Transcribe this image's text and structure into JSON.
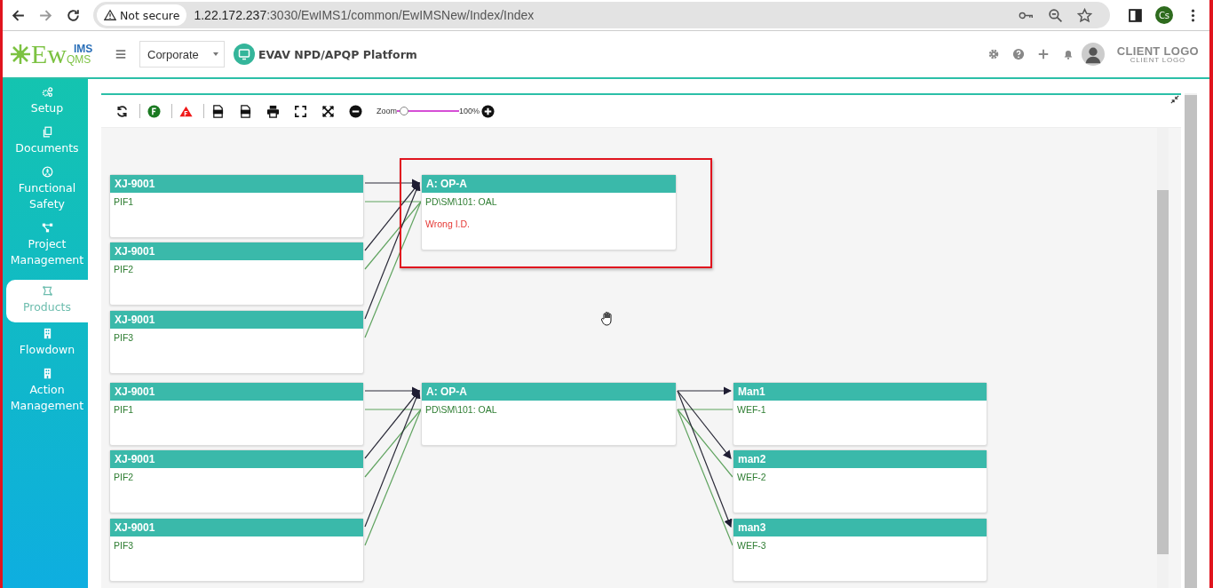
{
  "browser": {
    "security": "Not secure",
    "url_host": "1.22.172.237",
    "url_rest": ":3030/EwIMS1/common/EwIMSNew/Index/Index",
    "profile": "Cs"
  },
  "header": {
    "logo": {
      "main": "Ew",
      "top": "IMS",
      "bottom": "QMS"
    },
    "org_select": "Corporate",
    "platform": "EVAV NPD/APQP Platform",
    "client_logo": "CLIENT LOGO",
    "client_logo_sub": "CLIENT LOGO"
  },
  "sidebar": {
    "items": [
      {
        "label": "Setup",
        "selected": false
      },
      {
        "label": "Documents",
        "selected": false
      },
      {
        "label": "Functional Safety",
        "selected": false
      },
      {
        "label": "Project Management",
        "selected": false
      },
      {
        "label": "Products",
        "selected": true
      },
      {
        "label": "Flowdown",
        "selected": false
      },
      {
        "label": "Action Management",
        "selected": false
      }
    ]
  },
  "toolbar": {
    "zoom_label": "Zoom",
    "zoom": {
      "level": 0.1
    },
    "zoom_value": "100%"
  },
  "diagram": {
    "nodes": [
      {
        "title": "XJ-9001",
        "flagged": false,
        "rows": [
          {
            "text": "PIF1",
            "kind": "ok"
          }
        ]
      },
      {
        "title": "XJ-9001",
        "flagged": false,
        "rows": [
          {
            "text": "PIF2",
            "kind": "ok"
          }
        ]
      },
      {
        "title": "XJ-9001",
        "flagged": false,
        "rows": [
          {
            "text": "PIF3",
            "kind": "ok"
          }
        ]
      },
      {
        "title": "A: OP-A",
        "flagged": true,
        "rows": [
          {
            "text": "PD\\SM\\101: OAL",
            "kind": "ok"
          },
          {
            "text": "Wrong I.D.",
            "kind": "error"
          }
        ]
      },
      {
        "title": "XJ-9001",
        "flagged": false,
        "rows": [
          {
            "text": "PIF1",
            "kind": "ok"
          }
        ]
      },
      {
        "title": "XJ-9001",
        "flagged": false,
        "rows": [
          {
            "text": "PIF2",
            "kind": "ok"
          }
        ]
      },
      {
        "title": "XJ-9001",
        "flagged": false,
        "rows": [
          {
            "text": "PIF3",
            "kind": "ok"
          }
        ]
      },
      {
        "title": "A: OP-A",
        "flagged": false,
        "rows": [
          {
            "text": "PD\\SM\\101: OAL",
            "kind": "ok"
          }
        ]
      },
      {
        "title": "Man1",
        "flagged": false,
        "rows": [
          {
            "text": "WEF-1",
            "kind": "ok"
          }
        ]
      },
      {
        "title": "man2",
        "flagged": false,
        "rows": [
          {
            "text": "WEF-2",
            "kind": "ok"
          }
        ]
      },
      {
        "title": "man3",
        "flagged": false,
        "rows": [
          {
            "text": "WEF-3",
            "kind": "ok"
          }
        ]
      }
    ]
  }
}
